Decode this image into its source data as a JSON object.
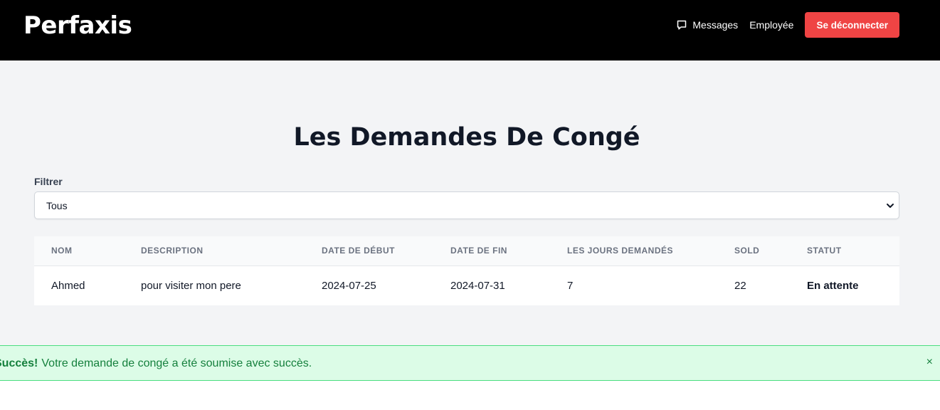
{
  "navbar": {
    "brand": "Perfaxis",
    "messages_label": "Messages",
    "employee_label": "Employée",
    "logout_label": "Se déconnecter"
  },
  "page": {
    "title": "Les Demandes De Congé"
  },
  "filter": {
    "label": "Filtrer",
    "selected": "Tous"
  },
  "table": {
    "headers": [
      "NOM",
      "DESCRIPTION",
      "DATE DE DÉBUT",
      "DATE DE FIN",
      "LES JOURS DEMANDÉS",
      "SOLD",
      "STATUT"
    ],
    "rows": [
      [
        "Ahmed",
        "pour visiter mon pere",
        "2024-07-25",
        "2024-07-31",
        "7",
        "22",
        "En attente"
      ]
    ]
  },
  "alert": {
    "title": "Succès!",
    "message": "Votre demande de congé a été soumise avec succès.",
    "close": "×"
  },
  "colors": {
    "navbar": "#000000",
    "logout_button": "#ef4444",
    "page_background": "#f3f4f6",
    "alert_background": "#dcfce7",
    "alert_text": "#15803d"
  },
  "icons": {
    "messages": "chat-bubble-icon",
    "select": "chevron-down-icon"
  }
}
